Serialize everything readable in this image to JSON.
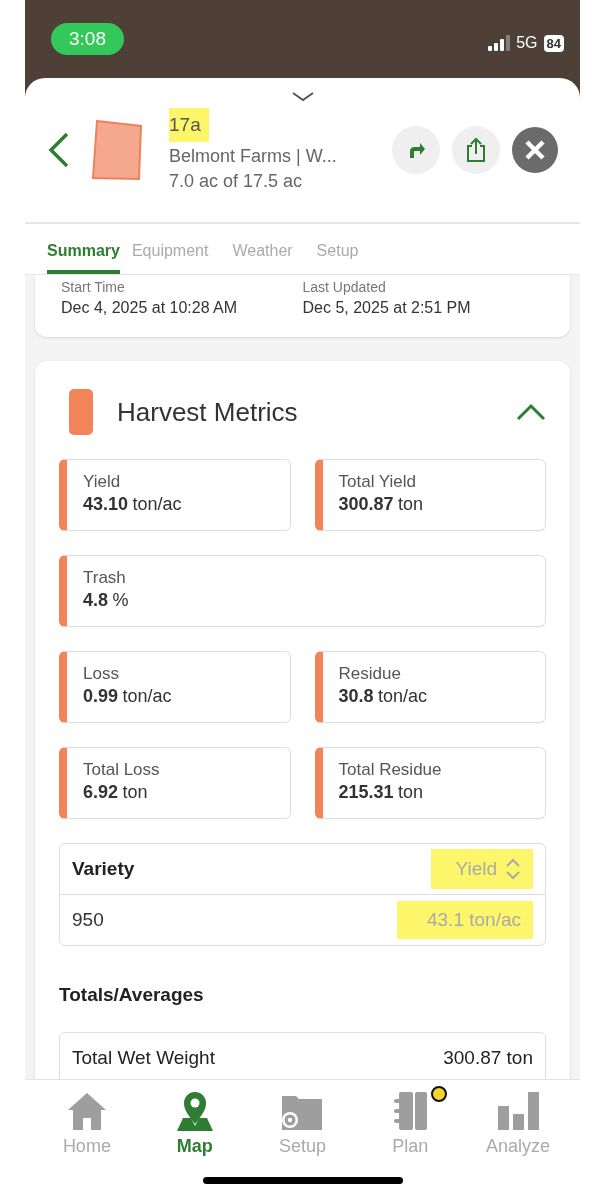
{
  "status_bar": {
    "time": "3:08",
    "network": "5G",
    "battery": "84"
  },
  "header": {
    "field_name": "17a",
    "field_name_highlighted": true,
    "farm": "Belmont Farms | W...",
    "area": "7.0 ac of 17.5 ac"
  },
  "tabs": [
    {
      "label": "Summary",
      "selected": true
    },
    {
      "label": "Equipment",
      "selected": false
    },
    {
      "label": "Weather",
      "selected": false
    },
    {
      "label": "Setup",
      "selected": false
    }
  ],
  "times": [
    {
      "label": "Start Time",
      "value": "Dec 4, 2025 at 10:28 AM"
    },
    {
      "label": "Last Updated",
      "value": "Dec 5, 2025 at 2:51 PM"
    }
  ],
  "metrics_card": {
    "title": "Harvest Metrics",
    "expanded": true,
    "metrics": [
      {
        "label": "Yield",
        "value": "43.10",
        "unit": "ton/ac",
        "wide": false
      },
      {
        "label": "Total Yield",
        "value": "300.87",
        "unit": "ton",
        "wide": false
      },
      {
        "label": "Trash",
        "value": "4.8",
        "unit": "%",
        "wide": true
      },
      {
        "label": "Loss",
        "value": "0.99",
        "unit": "ton/ac",
        "wide": false
      },
      {
        "label": "Residue",
        "value": "30.8",
        "unit": "ton/ac",
        "wide": false
      },
      {
        "label": "Total Loss",
        "value": "6.92",
        "unit": "ton",
        "wide": false
      },
      {
        "label": "Total Residue",
        "value": "215.31",
        "unit": "ton",
        "wide": false
      }
    ],
    "variety_table": {
      "column": "Variety",
      "sort_label": "Yield",
      "sort_highlighted": true,
      "rows": [
        {
          "variety": "950",
          "value": "43.1 ton/ac",
          "highlighted": true
        }
      ]
    },
    "totals_heading": "Totals/Averages",
    "totals": [
      {
        "label": "Total Wet Weight",
        "value": "300.87 ton"
      }
    ]
  },
  "nav": [
    {
      "label": "Home",
      "kind": "home",
      "selected": false,
      "badge": false
    },
    {
      "label": "Map",
      "kind": "map",
      "selected": true,
      "badge": false
    },
    {
      "label": "Setup",
      "kind": "setup",
      "selected": false,
      "badge": false
    },
    {
      "label": "Plan",
      "kind": "plan",
      "selected": false,
      "badge": true
    },
    {
      "label": "Analyze",
      "kind": "analyze",
      "selected": false,
      "badge": false
    }
  ]
}
